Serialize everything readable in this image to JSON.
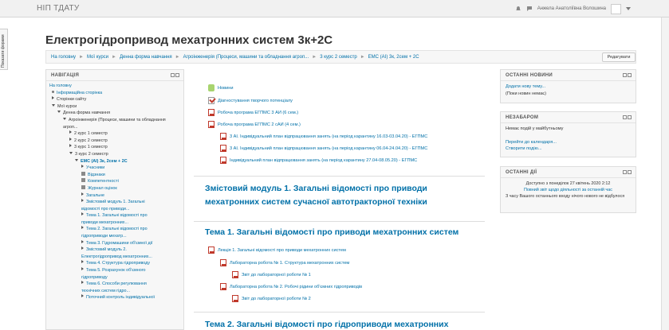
{
  "navbar": {
    "brand": "НІП ТДАТУ",
    "user": "Анжела Анатоліївна Волошина"
  },
  "side_tab": "Показати форами",
  "page_title": "Електрогідропривод мехатронних систем 3к+2С",
  "breadcrumb": [
    "На головну",
    "Мої курси",
    "Денна форма навчання",
    "Агроінженерія (Процеси, машини та обладнання агроп...",
    "3 курс 2 семестр",
    "ЕМС (АІ) 3к, 2сем + 2С"
  ],
  "edit_button": "Редагувати",
  "navigation": {
    "title": "НАВІГАЦІЯ",
    "items": [
      "На головну",
      "Інформаційна сторінка",
      "Сторінки сайту",
      "Мої курси",
      "Денна форма навчання",
      "Агроінженерія (Процеси, машини та обладнання агроп...",
      "2 курс 1 семестр",
      "2 курс 2 семестр",
      "3 курс 1 семестр",
      "3 курс 2 семестр",
      "ЕМС (АІ) 3к, 2сем + 2С",
      "Учасники",
      "Відзнаки",
      "Компетентності",
      "Журнал оцінок",
      "Загальне",
      "Змістовий модуль 1. Загальні відомості про приводи...",
      "Тема 1. Загальні відомості про приводи мехатронних...",
      "Тема 2. Загальні відомості про гідроприводи мехатр...",
      "Тема 3. Гідромашини об'ємної дії",
      "Змістовий модуль 2. Електрогідропривод мехатронних...",
      "Тема 4. Структура гідроприводу",
      "Тема 5. Розрахунок об'ємного гідроприводу",
      "Тема 6. Способи регулювання технічних систем гідро...",
      "Поточний контроль індивідуальної"
    ]
  },
  "main": {
    "links": [
      "Новини",
      "Діагностування творчого потенціалу",
      "Робоча програма ЕГПМС 3 АИ (6 сем.)",
      "Робоча програма ЕГПМС 2 сАИ (4 сем.)",
      "3 АІ. Індивідуальний план відпрацювання занять (на період карантину 16.03-03.04.20) - ЕГПМС",
      "3 АІ. Індивідуальний план відпрацювання занять (на період карантину 06.04-24.04.20) - ЕГПМС",
      "Індивідуальний план відпрацювання занять (на період карантину 27.04-08.05.20) - ЕГПМС"
    ],
    "module1_title": "Змістовий модуль 1. Загальні відомості про приводи мехатронних систем сучасної автотракторної техніки",
    "topic1_title": "Тема 1. Загальні відомості про приводи мехатронних систем",
    "topic1_items": [
      "Лекція 1. Загальні відомості про приводи мехатронних систем",
      "Лабораторна робота № 1. Структура мехатронних систем",
      "Звіт до лабораторної роботи № 1",
      "Лабораторна робота № 2. Робочі рідини об'ємних гідроприводів",
      "Звіт до лабораторної роботи № 2"
    ],
    "topic2_title": "Тема 2. Загальні відомості про гідроприводи мехатронних"
  },
  "news_block": {
    "title": "ОСТАННІ НОВИНИ",
    "add_link": "Додати нову тему...",
    "empty": "(Поки новин немає)"
  },
  "events_block": {
    "title": "НЕЗАБАРОМ",
    "empty": "Немає подій у майбутньому",
    "calendar_link": "Перейти до календаря...",
    "new_event_link": "Створити подію..."
  },
  "activity_block": {
    "title": "ОСТАННІ ДІЇ",
    "since": "Доступно з понеділок 27 квітень 2020 2:12",
    "full_report": "Повний звіт щодо діяльності за останній час",
    "nothing": "З часу Вашого останнього входу нічого нового не відбулося"
  }
}
